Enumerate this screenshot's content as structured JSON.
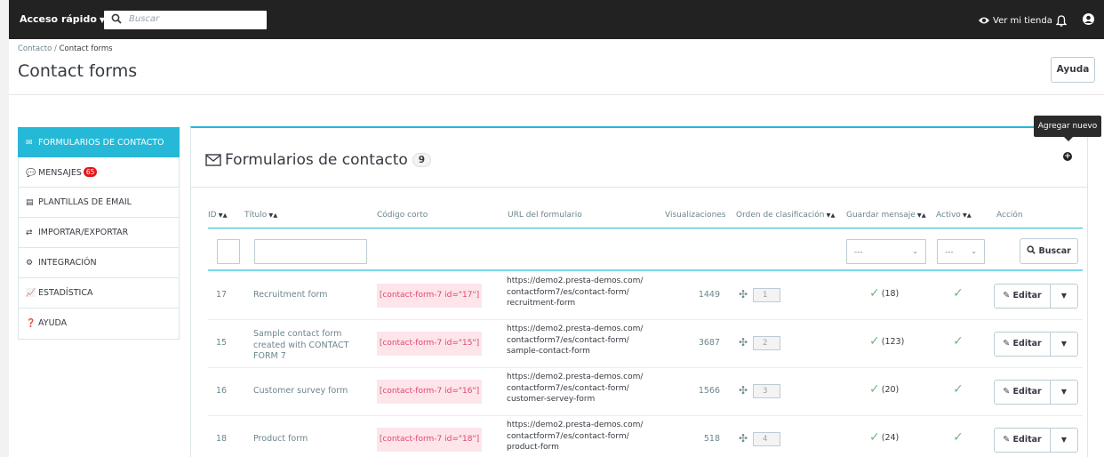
{
  "topbar": {
    "quick_access": "Acceso rápido",
    "search_placeholder": "Buscar",
    "view_shop": "Ver mi tienda"
  },
  "breadcrumb": {
    "parent": "Contacto",
    "separator": "/",
    "current": "Contact forms"
  },
  "page_title": "Contact forms",
  "help_button": "Ayuda",
  "sidebar": {
    "items": [
      {
        "label": "FORMULARIOS DE CONTACTO",
        "icon": "envelope-icon",
        "active": true
      },
      {
        "label": "MENSAJES",
        "icon": "comments-icon",
        "badge": "65"
      },
      {
        "label": "PLANTILLAS DE EMAIL",
        "icon": "file-icon"
      },
      {
        "label": "IMPORTAR/EXPORTAR",
        "icon": "exchange-icon"
      },
      {
        "label": "INTEGRACIÓN",
        "icon": "cogs-icon"
      },
      {
        "label": "ESTADÍSTICA",
        "icon": "line-chart-icon"
      },
      {
        "label": "AYUDA",
        "icon": "question-circle-icon"
      }
    ]
  },
  "panel": {
    "title": "Formularios de contacto",
    "count": "9",
    "add_tooltip": "Agregar nuevo"
  },
  "table": {
    "headers": {
      "id": "ID",
      "title": "Título",
      "shortcode": "Código corto",
      "url": "URL del formulario",
      "views": "Visualizaciones",
      "order": "Orden de clasificación",
      "save": "Guardar mensaje",
      "active": "Activo",
      "action": "Acción"
    },
    "filters": {
      "select_placeholder": "---",
      "search_button": "Buscar"
    },
    "rows": [
      {
        "id": "17",
        "title": "Recruitment form",
        "shortcode": "[contact-form-7 id=\"17\"]",
        "url_lines": [
          "https://demo2.presta-demos.com/",
          "contactform7/es/contact-form/",
          "recruitment-form"
        ],
        "views": "1449",
        "position": "1",
        "saved": "(18)",
        "edit": "Editar"
      },
      {
        "id": "15",
        "title": "Sample contact form created with CONTACT FORM 7",
        "shortcode": "[contact-form-7 id=\"15\"]",
        "url_lines": [
          "https://demo2.presta-demos.com/",
          "contactform7/es/contact-form/",
          "sample-contact-form"
        ],
        "views": "3687",
        "position": "2",
        "saved": "(123)",
        "edit": "Editar"
      },
      {
        "id": "16",
        "title": "Customer survey form",
        "shortcode": "[contact-form-7 id=\"16\"]",
        "url_lines": [
          "https://demo2.presta-demos.com/",
          "contactform7/es/contact-form/",
          "customer-servey-form"
        ],
        "views": "1566",
        "position": "3",
        "saved": "(20)",
        "edit": "Editar"
      },
      {
        "id": "18",
        "title": "Product form",
        "shortcode": "[contact-form-7 id=\"18\"]",
        "url_lines": [
          "https://demo2.presta-demos.com/",
          "contactform7/es/contact-form/",
          "product-form"
        ],
        "views": "518",
        "position": "4",
        "saved": "(24)",
        "edit": "Editar"
      }
    ]
  },
  "colors": {
    "accent": "#25b9d7",
    "topbar": "#222222",
    "success": "#70b580",
    "shortcode_bg": "#fde5ea",
    "shortcode_text": "#e0476b",
    "badge": "#e3171b"
  }
}
